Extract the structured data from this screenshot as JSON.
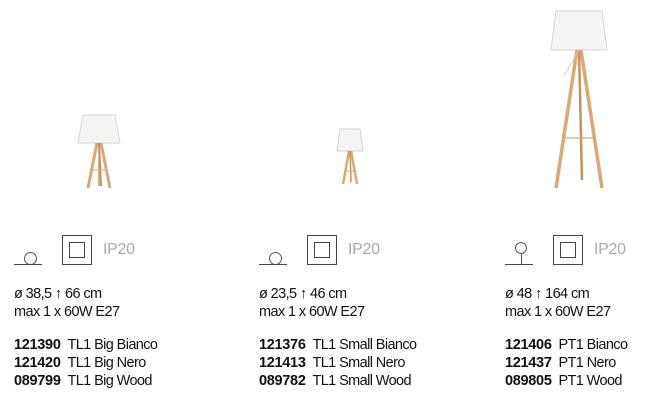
{
  "products": [
    {
      "type": "table",
      "ip": "IP20",
      "dims": "ø 38,5 ↑ 66 cm",
      "power": "max 1 x 60W E27",
      "variants": [
        {
          "code": "121390",
          "name": "TL1 Big Bianco"
        },
        {
          "code": "121420",
          "name": "TL1 Big Nero"
        },
        {
          "code": "089799",
          "name": "TL1 Big Wood"
        }
      ]
    },
    {
      "type": "table",
      "ip": "IP20",
      "dims": "ø 23,5 ↑ 46 cm",
      "power": "max 1 x 60W E27",
      "variants": [
        {
          "code": "121376",
          "name": "TL1 Small Bianco"
        },
        {
          "code": "121413",
          "name": "TL1 Small Nero"
        },
        {
          "code": "089782",
          "name": "TL1 Small Wood"
        }
      ]
    },
    {
      "type": "floor",
      "ip": "IP20",
      "dims": "ø 48 ↑ 164 cm",
      "power": "max 1 x 60W E27",
      "variants": [
        {
          "code": "121406",
          "name": "PT1 Bianco"
        },
        {
          "code": "121437",
          "name": "PT1 Nero"
        },
        {
          "code": "089805",
          "name": "PT1 Wood"
        }
      ]
    }
  ],
  "colors": {
    "shade": "#f3f3f1",
    "wood": "#d9a878",
    "ip_text": "#a9a9a9"
  }
}
